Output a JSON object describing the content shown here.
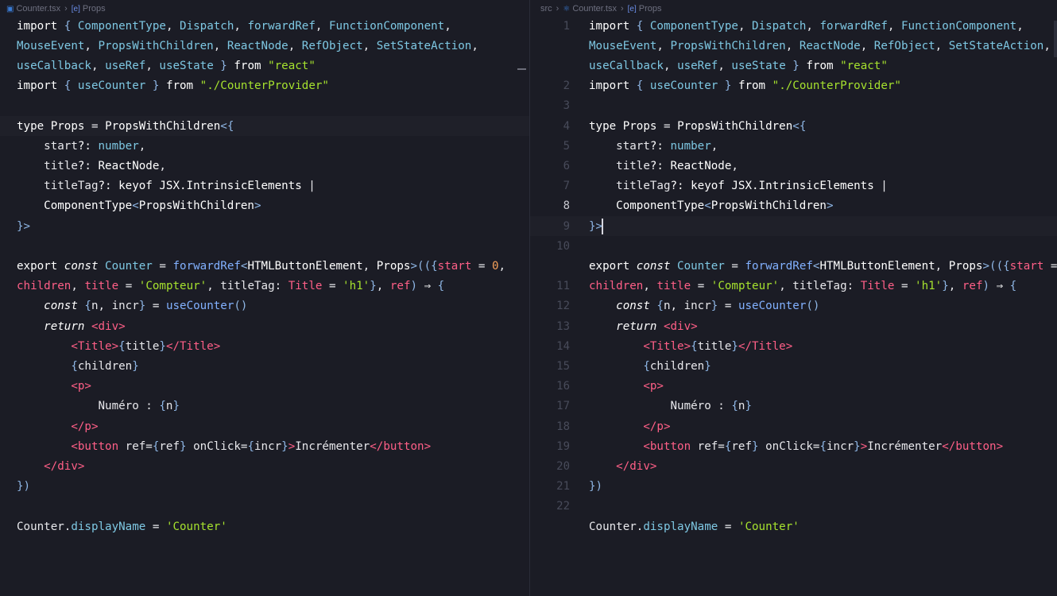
{
  "left_pane": {
    "breadcrumb": {
      "file": "Counter.tsx",
      "symbol": "Props"
    },
    "lines": [
      [
        [
          "kw",
          "import "
        ],
        [
          "punc",
          "{ "
        ],
        [
          "id",
          "ComponentType"
        ],
        [
          "plain",
          ", "
        ],
        [
          "id",
          "Dispatch"
        ],
        [
          "plain",
          ", "
        ],
        [
          "id",
          "forwardRef"
        ],
        [
          "plain",
          ", "
        ],
        [
          "id",
          "FunctionComponent"
        ],
        [
          "plain",
          ","
        ]
      ],
      [
        [
          "id",
          "MouseEvent"
        ],
        [
          "plain",
          ", "
        ],
        [
          "id",
          "PropsWithChildren"
        ],
        [
          "plain",
          ", "
        ],
        [
          "id",
          "ReactNode"
        ],
        [
          "plain",
          ", "
        ],
        [
          "id",
          "RefObject"
        ],
        [
          "plain",
          ", "
        ],
        [
          "id",
          "SetStateAction"
        ],
        [
          "plain",
          ","
        ]
      ],
      [
        [
          "id",
          "useCallback"
        ],
        [
          "plain",
          ", "
        ],
        [
          "id",
          "useRef"
        ],
        [
          "plain",
          ", "
        ],
        [
          "id",
          "useState"
        ],
        [
          "punc",
          " } "
        ],
        [
          "kw",
          "from "
        ],
        [
          "str",
          "\"react\""
        ]
      ],
      [
        [
          "kw",
          "import "
        ],
        [
          "punc",
          "{ "
        ],
        [
          "id",
          "useCounter"
        ],
        [
          "punc",
          " } "
        ],
        [
          "kw",
          "from "
        ],
        [
          "str",
          "\"./CounterProvider\""
        ]
      ],
      [],
      [
        [
          "kw",
          "type "
        ],
        [
          "typ",
          "Props "
        ],
        [
          "plain",
          "= "
        ],
        [
          "typ",
          "PropsWithChildren"
        ],
        [
          "punc",
          "<{"
        ]
      ],
      [
        [
          "plain",
          "    start"
        ],
        [
          "kw",
          "?: "
        ],
        [
          "id",
          "number"
        ],
        [
          "plain",
          ","
        ]
      ],
      [
        [
          "plain",
          "    title"
        ],
        [
          "kw",
          "?: "
        ],
        [
          "typ",
          "ReactNode"
        ],
        [
          "plain",
          ","
        ]
      ],
      [
        [
          "plain",
          "    titleTag"
        ],
        [
          "kw",
          "?: "
        ],
        [
          "kw",
          "keyof "
        ],
        [
          "typ",
          "JSX.IntrinsicElements "
        ],
        [
          "plain",
          "|"
        ]
      ],
      [
        [
          "typ",
          "    ComponentType"
        ],
        [
          "punc",
          "<"
        ],
        [
          "typ",
          "PropsWithChildren"
        ],
        [
          "punc",
          ">"
        ]
      ],
      [
        [
          "punc",
          "}>"
        ]
      ],
      [],
      [
        [
          "kw",
          "export "
        ],
        [
          "it",
          "const "
        ],
        [
          "id",
          "Counter "
        ],
        [
          "plain",
          "= "
        ],
        [
          "fn",
          "forwardRef"
        ],
        [
          "punc",
          "<"
        ],
        [
          "typ",
          "HTMLButtonElement"
        ],
        [
          "plain",
          ", "
        ],
        [
          "typ",
          "Props"
        ],
        [
          "punc",
          ">"
        ],
        [
          "punc",
          "(({"
        ],
        [
          "tag",
          "start "
        ],
        [
          "plain",
          "= "
        ],
        [
          "num",
          "0"
        ],
        [
          "plain",
          ","
        ]
      ],
      [
        [
          "tag",
          "children"
        ],
        [
          "plain",
          ", "
        ],
        [
          "tag",
          "title "
        ],
        [
          "plain",
          "= "
        ],
        [
          "str",
          "'Compteur'"
        ],
        [
          "plain",
          ", titleTag: "
        ],
        [
          "tag",
          "Title "
        ],
        [
          "plain",
          "= "
        ],
        [
          "str",
          "'h1'"
        ],
        [
          "punc",
          "}"
        ],
        [
          "plain",
          ", "
        ],
        [
          "tag",
          "ref"
        ],
        [
          "punc",
          ") "
        ],
        [
          "kw",
          "⇒ "
        ],
        [
          "punc",
          "{"
        ]
      ],
      [
        [
          "it",
          "    const "
        ],
        [
          "punc",
          "{"
        ],
        [
          "plain",
          "n, "
        ],
        [
          "plain",
          "incr"
        ],
        [
          "punc",
          "} "
        ],
        [
          "plain",
          "= "
        ],
        [
          "fn",
          "useCounter"
        ],
        [
          "punc",
          "()"
        ]
      ],
      [
        [
          "it",
          "    return "
        ],
        [
          "tag",
          "<div>"
        ]
      ],
      [
        [
          "tag",
          "        <Title>"
        ],
        [
          "punc",
          "{"
        ],
        [
          "plain",
          "title"
        ],
        [
          "punc",
          "}"
        ],
        [
          "tag",
          "</Title>"
        ]
      ],
      [
        [
          "punc",
          "        {"
        ],
        [
          "plain",
          "children"
        ],
        [
          "punc",
          "}"
        ]
      ],
      [
        [
          "tag",
          "        <p>"
        ]
      ],
      [
        [
          "plain",
          "            Numéro : "
        ],
        [
          "punc",
          "{"
        ],
        [
          "plain",
          "n"
        ],
        [
          "punc",
          "}"
        ]
      ],
      [
        [
          "tag",
          "        </p>"
        ]
      ],
      [
        [
          "tag",
          "        <button "
        ],
        [
          "plain",
          "ref="
        ],
        [
          "punc",
          "{"
        ],
        [
          "plain",
          "ref"
        ],
        [
          "punc",
          "} "
        ],
        [
          "plain",
          "onClick="
        ],
        [
          "punc",
          "{"
        ],
        [
          "plain",
          "incr"
        ],
        [
          "punc",
          "}"
        ],
        [
          "tag",
          ">"
        ],
        [
          "plain",
          "Incrémenter"
        ],
        [
          "tag",
          "</button>"
        ]
      ],
      [
        [
          "tag",
          "    </div>"
        ]
      ],
      [
        [
          "punc",
          "})"
        ]
      ],
      [],
      [
        [
          "plain",
          "Counter."
        ],
        [
          "id",
          "displayName "
        ],
        [
          "plain",
          "= "
        ],
        [
          "str",
          "'Counter'"
        ]
      ]
    ]
  },
  "right_pane": {
    "breadcrumb": {
      "folder": "src",
      "file": "Counter.tsx",
      "symbol": "Props"
    },
    "line_numbers": [
      "1",
      "",
      "",
      "2",
      "3",
      "4",
      "5",
      "6",
      "7",
      "8",
      "9",
      "10",
      "",
      "11",
      "12",
      "13",
      "14",
      "15",
      "16",
      "17",
      "18",
      "19",
      "20",
      "21",
      "22"
    ],
    "active_line": "8",
    "lines": [
      [
        [
          "kw",
          "import "
        ],
        [
          "punc",
          "{ "
        ],
        [
          "id",
          "ComponentType"
        ],
        [
          "plain",
          ", "
        ],
        [
          "id",
          "Dispatch"
        ],
        [
          "plain",
          ", "
        ],
        [
          "id",
          "forwardRef"
        ],
        [
          "plain",
          ", "
        ],
        [
          "id",
          "FunctionComponent"
        ],
        [
          "plain",
          ","
        ]
      ],
      [
        [
          "id",
          "MouseEvent"
        ],
        [
          "plain",
          ", "
        ],
        [
          "id",
          "PropsWithChildren"
        ],
        [
          "plain",
          ", "
        ],
        [
          "id",
          "ReactNode"
        ],
        [
          "plain",
          ", "
        ],
        [
          "id",
          "RefObject"
        ],
        [
          "plain",
          ", "
        ],
        [
          "id",
          "SetStateAction"
        ],
        [
          "plain",
          ","
        ]
      ],
      [
        [
          "id",
          "useCallback"
        ],
        [
          "plain",
          ", "
        ],
        [
          "id",
          "useRef"
        ],
        [
          "plain",
          ", "
        ],
        [
          "id",
          "useState"
        ],
        [
          "punc",
          " } "
        ],
        [
          "kw",
          "from "
        ],
        [
          "str",
          "\"react\""
        ]
      ],
      [
        [
          "kw",
          "import "
        ],
        [
          "punc",
          "{ "
        ],
        [
          "id",
          "useCounter"
        ],
        [
          "punc",
          " } "
        ],
        [
          "kw",
          "from "
        ],
        [
          "str",
          "\"./CounterProvider\""
        ]
      ],
      [],
      [
        [
          "kw",
          "type "
        ],
        [
          "typ",
          "Props "
        ],
        [
          "plain",
          "= "
        ],
        [
          "typ",
          "PropsWithChildren"
        ],
        [
          "punc",
          "<{"
        ]
      ],
      [
        [
          "plain",
          "    start"
        ],
        [
          "kw",
          "?: "
        ],
        [
          "id",
          "number"
        ],
        [
          "plain",
          ","
        ]
      ],
      [
        [
          "plain",
          "    title"
        ],
        [
          "kw",
          "?: "
        ],
        [
          "typ",
          "ReactNode"
        ],
        [
          "plain",
          ","
        ]
      ],
      [
        [
          "plain",
          "    titleTag"
        ],
        [
          "kw",
          "?: "
        ],
        [
          "kw",
          "keyof "
        ],
        [
          "typ",
          "JSX.IntrinsicElements "
        ],
        [
          "plain",
          "|"
        ]
      ],
      [
        [
          "typ",
          "    ComponentType"
        ],
        [
          "punc",
          "<"
        ],
        [
          "typ",
          "PropsWithChildren"
        ],
        [
          "punc",
          ">"
        ]
      ],
      [
        [
          "punc",
          "}>"
        ]
      ],
      [],
      [
        [
          "kw",
          "export "
        ],
        [
          "it",
          "const "
        ],
        [
          "id",
          "Counter "
        ],
        [
          "plain",
          "= "
        ],
        [
          "fn",
          "forwardRef"
        ],
        [
          "punc",
          "<"
        ],
        [
          "typ",
          "HTMLButtonElement"
        ],
        [
          "plain",
          ", "
        ],
        [
          "typ",
          "Props"
        ],
        [
          "punc",
          ">"
        ],
        [
          "punc",
          "(({"
        ],
        [
          "tag",
          "start "
        ],
        [
          "plain",
          "="
        ]
      ],
      [
        [
          "tag",
          "children"
        ],
        [
          "plain",
          ", "
        ],
        [
          "tag",
          "title "
        ],
        [
          "plain",
          "= "
        ],
        [
          "str",
          "'Compteur'"
        ],
        [
          "plain",
          ", titleTag: "
        ],
        [
          "tag",
          "Title "
        ],
        [
          "plain",
          "= "
        ],
        [
          "str",
          "'h1'"
        ],
        [
          "punc",
          "}"
        ],
        [
          "plain",
          ", "
        ],
        [
          "tag",
          "ref"
        ],
        [
          "punc",
          ") "
        ],
        [
          "kw",
          "⇒ "
        ],
        [
          "punc",
          "{"
        ]
      ],
      [
        [
          "it",
          "    const "
        ],
        [
          "punc",
          "{"
        ],
        [
          "plain",
          "n, "
        ],
        [
          "plain",
          "incr"
        ],
        [
          "punc",
          "} "
        ],
        [
          "plain",
          "= "
        ],
        [
          "fn",
          "useCounter"
        ],
        [
          "punc",
          "()"
        ]
      ],
      [
        [
          "it",
          "    return "
        ],
        [
          "tag",
          "<div>"
        ]
      ],
      [
        [
          "tag",
          "        <Title>"
        ],
        [
          "punc",
          "{"
        ],
        [
          "plain",
          "title"
        ],
        [
          "punc",
          "}"
        ],
        [
          "tag",
          "</Title>"
        ]
      ],
      [
        [
          "punc",
          "        {"
        ],
        [
          "plain",
          "children"
        ],
        [
          "punc",
          "}"
        ]
      ],
      [
        [
          "tag",
          "        <p>"
        ]
      ],
      [
        [
          "plain",
          "            Numéro : "
        ],
        [
          "punc",
          "{"
        ],
        [
          "plain",
          "n"
        ],
        [
          "punc",
          "}"
        ]
      ],
      [
        [
          "tag",
          "        </p>"
        ]
      ],
      [
        [
          "tag",
          "        <button "
        ],
        [
          "plain",
          "ref="
        ],
        [
          "punc",
          "{"
        ],
        [
          "plain",
          "ref"
        ],
        [
          "punc",
          "} "
        ],
        [
          "plain",
          "onClick="
        ],
        [
          "punc",
          "{"
        ],
        [
          "plain",
          "incr"
        ],
        [
          "punc",
          "}"
        ],
        [
          "tag",
          ">"
        ],
        [
          "plain",
          "Incrémenter"
        ],
        [
          "tag",
          "</button>"
        ]
      ],
      [
        [
          "tag",
          "    </div>"
        ]
      ],
      [
        [
          "punc",
          "})"
        ]
      ],
      [],
      [
        [
          "plain",
          "Counter."
        ],
        [
          "id",
          "displayName "
        ],
        [
          "plain",
          "= "
        ],
        [
          "str",
          "'Counter'"
        ]
      ]
    ]
  }
}
